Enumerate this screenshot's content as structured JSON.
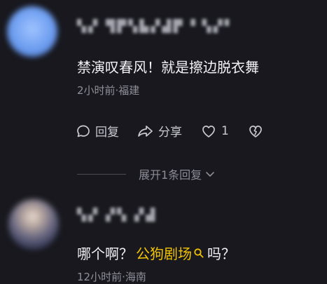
{
  "comments": [
    {
      "username": "",
      "text": "禁演叹春风！就是擦边脱衣舞",
      "meta": "2小时前·福建"
    },
    {
      "username": "",
      "text_before": "哪个啊？",
      "keyword": "公狗剧场",
      "text_after": "吗？",
      "meta": "12小时前·海南"
    }
  ],
  "actions": {
    "reply_label": "回复",
    "share_label": "分享",
    "like_count": "1"
  },
  "expand_replies": "展开1条回复",
  "colors": {
    "background": "#18181e",
    "keyword": "#f1c300",
    "muted": "#8f8f99"
  },
  "icons": [
    "reply-icon",
    "share-icon",
    "heart-icon",
    "broken-heart-icon",
    "chevron-down-icon",
    "search-icon"
  ]
}
